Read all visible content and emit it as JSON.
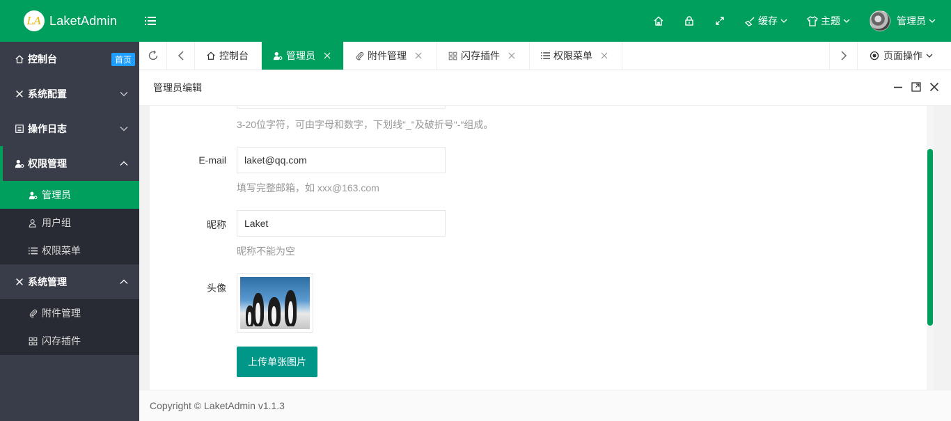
{
  "app": {
    "logo_mark": "LA",
    "title": "LaketAdmin"
  },
  "header": {
    "cache_label": "缓存",
    "theme_label": "主题",
    "user_label": "管理员"
  },
  "sidebar": {
    "dashboard": {
      "label": "控制台",
      "badge": "首页"
    },
    "system_config": {
      "label": "系统配置"
    },
    "op_log": {
      "label": "操作日志"
    },
    "permission": {
      "label": "权限管理",
      "children": [
        {
          "label": "管理员"
        },
        {
          "label": "用户组"
        },
        {
          "label": "权限菜单"
        }
      ]
    },
    "system_manage": {
      "label": "系统管理",
      "children": [
        {
          "label": "附件管理"
        },
        {
          "label": "闪存插件"
        }
      ]
    }
  },
  "tabs": [
    {
      "label": "控制台"
    },
    {
      "label": "管理员"
    },
    {
      "label": "附件管理"
    },
    {
      "label": "闪存插件"
    },
    {
      "label": "权限菜单"
    }
  ],
  "page_op": "页面操作",
  "panel": {
    "title": "管理员编辑"
  },
  "form": {
    "username_hint": "3-20位字符，可由字母和数字，下划线\"_\"及破折号\"-\"组成。",
    "email": {
      "label": "E-mail",
      "value": "laket@qq.com",
      "hint": "填写完整邮箱，如 xxx@163.com"
    },
    "nickname": {
      "label": "昵称",
      "value": "Laket",
      "hint": "昵称不能为空"
    },
    "avatar": {
      "label": "头像"
    },
    "upload_button": "上传单张图片"
  },
  "footer": "Copyright © LaketAdmin v1.1.3",
  "colors": {
    "primary": "#009f5d",
    "sidebar": "#393d49",
    "sidebar_sub": "#282b33",
    "button": "#009688",
    "badge": "#1e9fff"
  }
}
